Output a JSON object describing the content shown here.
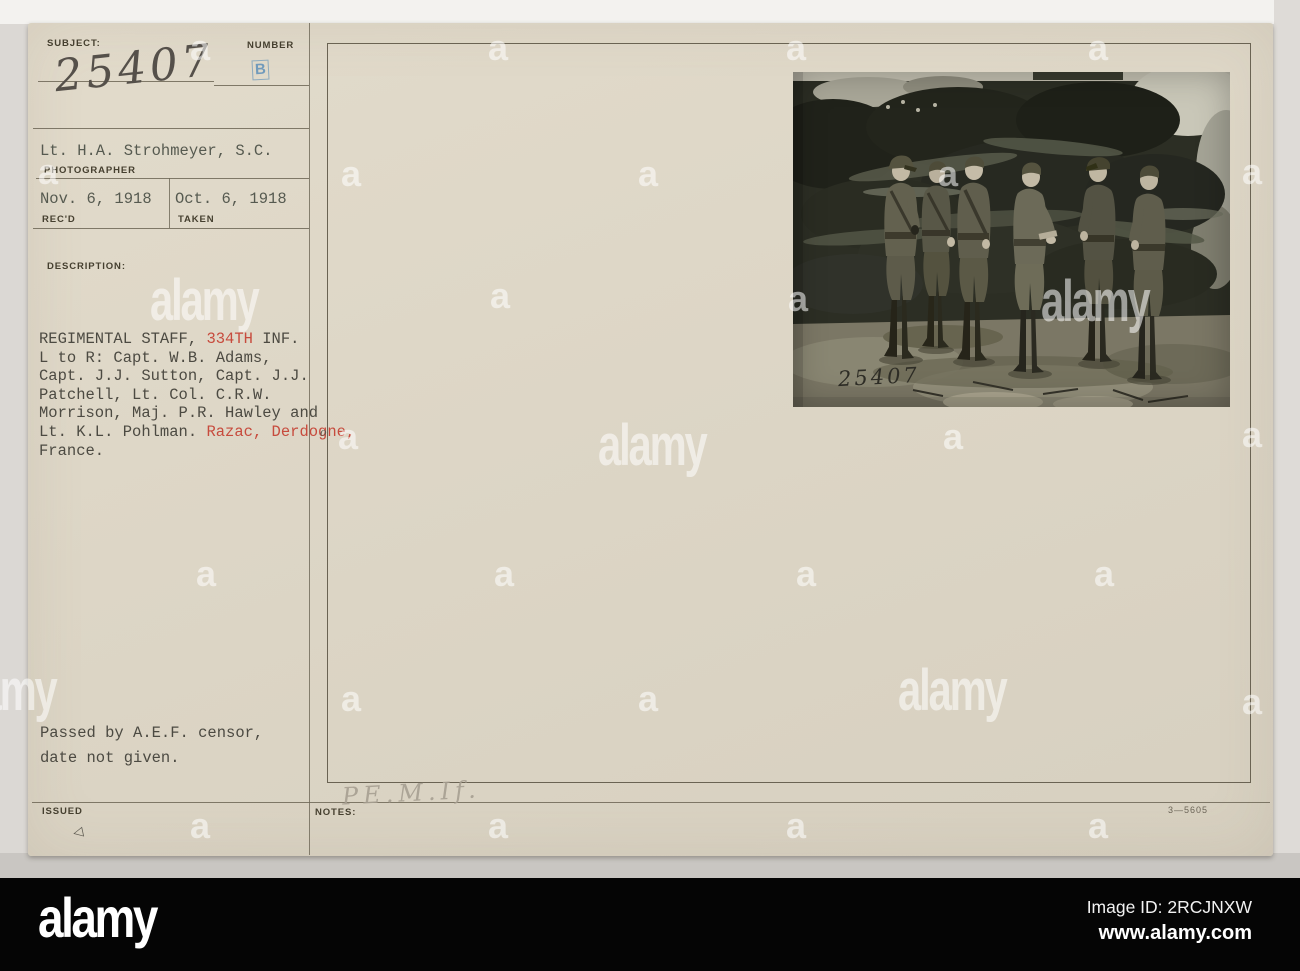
{
  "card": {
    "subject_label": "SUBJECT:",
    "subject_number": "25407",
    "number_label": "NUMBER",
    "number_stamp": "B",
    "photographer_name": "Lt. H.A. Strohmeyer, S.C.",
    "photographer_label": "PHOTOGRAPHER",
    "received_date": "Nov. 6, 1918",
    "received_label": "REC'D",
    "taken_date": "Oct. 6, 1918",
    "taken_label": "TAKEN",
    "description_label": "DESCRIPTION:",
    "description": {
      "line1_black": "REGIMENTAL STAFF, ",
      "line1_red": "334TH",
      "line1_tail": " INF.",
      "line2": "L to R: Capt. W.B. Adams,",
      "line3": "Capt. J.J. Sutton, Capt. J.J.",
      "line4": "Patchell, Lt. Col. C.R.W.",
      "line5": "Morrison, Maj. P.R. Hawley and",
      "line5_annotation": "o",
      "line6_black": "Lt. K.L. Pohlman. ",
      "line6_red": "Razac, Derdogne,",
      "line7": "France."
    },
    "censor_line1": "Passed by A.E.F. censor,",
    "censor_line2": "date not given.",
    "issued_label": "ISSUED",
    "issued_mark": "◁",
    "notes_label": "NOTES:",
    "pencil_note": "PE.M.If.",
    "print_number": "3—5605",
    "photo_caption_number": "25407"
  },
  "watermark": {
    "small": "a",
    "logo": "alamy"
  },
  "footer": {
    "logo": "alamy",
    "image_id": "Image ID: 2RCJNXW",
    "website": "www.alamy.com"
  },
  "colors": {
    "card_bg": "#ddd6c6",
    "rule_line": "#6d6656",
    "typed_text": "#565a50",
    "red_text": "#c74b3d",
    "label_text": "#453f2f",
    "stamp_blue": "#6694ba",
    "pencil": "#a79f92",
    "footer_bg": "#050505"
  }
}
